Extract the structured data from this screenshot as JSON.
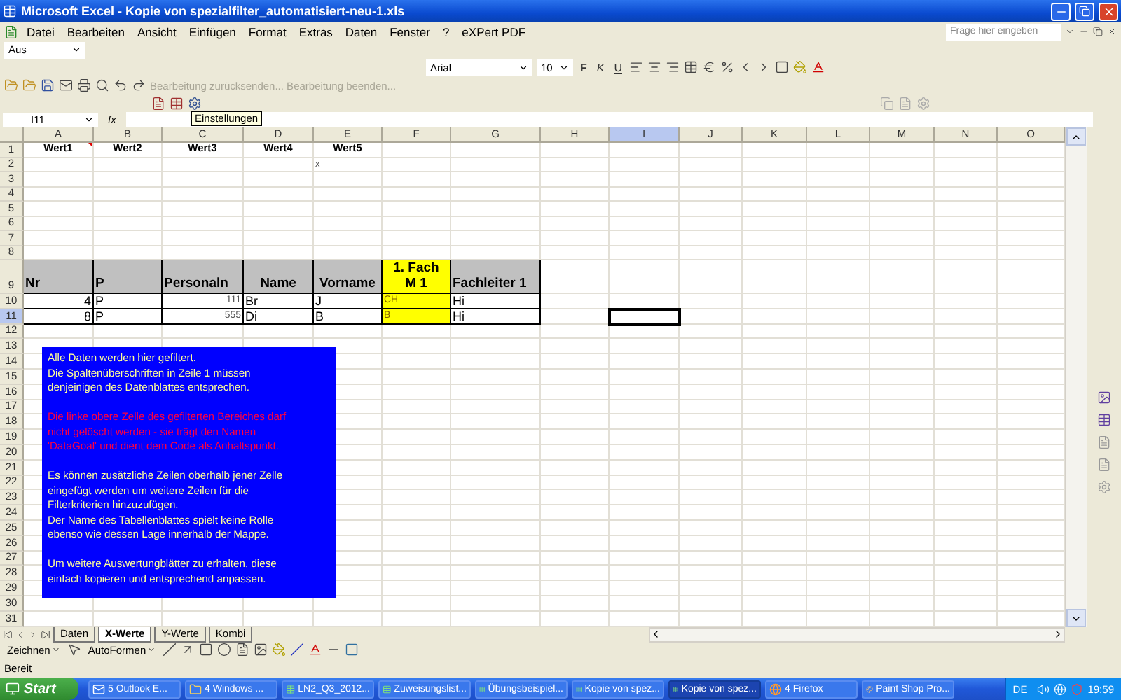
{
  "window": {
    "title": "Microsoft Excel - Kopie von spezialfilter_automatisiert-neu-1.xls"
  },
  "menu": [
    "Datei",
    "Bearbeiten",
    "Ansicht",
    "Einfügen",
    "Format",
    "Extras",
    "Daten",
    "Fenster",
    "?",
    "eXPert PDF"
  ],
  "help_search": {
    "placeholder": "Frage hier eingeben"
  },
  "style_box": {
    "value": "Aus"
  },
  "format_toolbar": {
    "font": "Arial",
    "size": "10",
    "buttons": [
      "F",
      "K",
      "U"
    ]
  },
  "review_toolbar": {
    "text": "Bearbeitung zurücksenden... Bearbeitung beenden...",
    "disabled": true
  },
  "tooltip": "Einstellungen",
  "formula_bar": {
    "name_box": "I11",
    "function_button": "fx"
  },
  "sheet": {
    "columns": [
      {
        "label": "A",
        "selected": false
      },
      {
        "label": "B",
        "selected": false
      },
      {
        "label": "C",
        "selected": false
      },
      {
        "label": "D",
        "selected": false
      },
      {
        "label": "E",
        "selected": false
      },
      {
        "label": "F",
        "selected": false
      },
      {
        "label": "G",
        "selected": false
      },
      {
        "label": "H",
        "selected": false
      },
      {
        "label": "I",
        "selected": true
      },
      {
        "label": "J",
        "selected": false
      },
      {
        "label": "K",
        "selected": false
      },
      {
        "label": "L",
        "selected": false
      },
      {
        "label": "M",
        "selected": false
      },
      {
        "label": "N",
        "selected": false
      },
      {
        "label": "O",
        "selected": false
      }
    ],
    "rows": [
      {
        "label": "1",
        "selected": false,
        "cells": [
          {
            "text": "Wert1",
            "kind": "label",
            "comment": true
          },
          {
            "text": "Wert2",
            "kind": "label"
          },
          {
            "text": "Wert3",
            "kind": "label"
          },
          {
            "text": "Wert4",
            "kind": "label"
          },
          {
            "text": "Wert5",
            "kind": "label"
          }
        ]
      },
      {
        "label": "2",
        "selected": false,
        "cells": [
          null,
          null,
          null,
          null,
          {
            "text": "x",
            "kind": "note"
          }
        ]
      },
      {
        "label": "3",
        "selected": false
      },
      {
        "label": "4",
        "selected": false
      },
      {
        "label": "5",
        "selected": false
      },
      {
        "label": "6",
        "selected": false
      },
      {
        "label": "7",
        "selected": false
      },
      {
        "label": "8",
        "selected": false
      },
      {
        "label": "9",
        "selected": false,
        "cells": [
          {
            "text": "Nr",
            "kind": "header"
          },
          {
            "text": "P",
            "kind": "header"
          },
          {
            "text": "Personaln",
            "kind": "header"
          },
          {
            "text": "Name",
            "kind": "centered_header"
          },
          {
            "text": "Vorname",
            "kind": "centered_header"
          },
          {
            "text": "1. Fach M 1",
            "kind": "highlight_header"
          },
          {
            "text": "Fachleiter 1",
            "kind": "header"
          }
        ]
      },
      {
        "label": "10",
        "selected": false,
        "cells": [
          {
            "text": "4",
            "kind": "number"
          },
          {
            "text": "P",
            "kind": "value"
          },
          {
            "text": "111",
            "kind": "small_value"
          },
          {
            "text": "Br",
            "kind": "value"
          },
          {
            "text": "J",
            "kind": "value"
          },
          {
            "text": "CH",
            "kind": "highlight_value"
          },
          {
            "text": "Hi",
            "kind": "value"
          }
        ]
      },
      {
        "label": "11",
        "selected": true,
        "cells": [
          {
            "text": "8",
            "kind": "number"
          },
          {
            "text": "P",
            "kind": "value"
          },
          {
            "text": "555",
            "kind": "small_value"
          },
          {
            "text": "Di",
            "kind": "value"
          },
          {
            "text": "B",
            "kind": "value"
          },
          {
            "text": "B",
            "kind": "highlight_value"
          },
          {
            "text": "Hi",
            "kind": "value"
          }
        ]
      },
      {
        "label": "12",
        "selected": false
      },
      {
        "label": "13",
        "selected": false
      },
      {
        "label": "14",
        "selected": false
      },
      {
        "label": "15",
        "selected": false
      },
      {
        "label": "16",
        "selected": false
      },
      {
        "label": "17",
        "selected": false
      },
      {
        "label": "18",
        "selected": false
      },
      {
        "label": "19",
        "selected": false
      },
      {
        "label": "20",
        "selected": false
      },
      {
        "label": "21",
        "selected": false
      },
      {
        "label": "22",
        "selected": false
      },
      {
        "label": "23",
        "selected": false
      },
      {
        "label": "24",
        "selected": false
      },
      {
        "label": "25",
        "selected": false
      },
      {
        "label": "26",
        "selected": false
      },
      {
        "label": "27",
        "selected": false
      },
      {
        "label": "28",
        "selected": false
      },
      {
        "label": "29",
        "selected": false
      },
      {
        "label": "30",
        "selected": false
      },
      {
        "label": "31",
        "selected": false
      }
    ]
  },
  "text_box": {
    "paragraphs": [
      {
        "text": "Alle Daten werden hier gefiltert.\nDie Spaltenüberschriften in Zeile 1 müssen\ndenjeinigen des Datenblattes entsprechen.",
        "color": "#ffff99"
      },
      {
        "text": "Die linke obere Zelle des gefilterten Bereiches darf\nnicht gelöscht werden - sie trägt den Namen\n'DataGoal' und dient dem Code als Anhaltspunkt.",
        "color": "#ff0040"
      },
      {
        "text": "Es können zusätzliche Zeilen oberhalb jener Zelle\neingefügt werden um weitere Zeilen für die\nFilterkriterien hinzuzufügen.\nDer Name des Tabellenblattes spielt keine Rolle\nebenso wie dessen Lage innerhalb der Mappe.",
        "color": "#ffff99"
      },
      {
        "text": "Um weitere Auswertungblätter zu erhalten, diese\neinfach kopieren und entsprechend anpassen.",
        "color": "#ffff99"
      }
    ]
  },
  "sheet_tabs": [
    {
      "label": "Daten",
      "selected": false
    },
    {
      "label": "X-Werte",
      "selected": true
    },
    {
      "label": "Y-Werte",
      "selected": false
    },
    {
      "label": "Kombi",
      "selected": false
    }
  ],
  "drawing_toolbar": {
    "draw_menu": "Zeichnen",
    "shapes_menu": "AutoFormen"
  },
  "status_bar": "Bereit",
  "taskbar": {
    "start": "Start",
    "items": [
      {
        "label": "5 Outlook E...",
        "kind": "mail",
        "selected": false
      },
      {
        "label": "4 Windows ...",
        "kind": "folder",
        "selected": false
      },
      {
        "label": "LN2_Q3_2012...",
        "kind": "sheet",
        "selected": false
      },
      {
        "label": "Zuweisungslist...",
        "kind": "sheet",
        "selected": false
      },
      {
        "label": "Übungsbeispiel...",
        "kind": "sheet",
        "selected": false
      },
      {
        "label": "Kopie von spez...",
        "kind": "sheet",
        "selected": false
      },
      {
        "label": "Kopie von spez...",
        "kind": "sheet",
        "selected": true
      },
      {
        "label": "4 Firefox",
        "kind": "browser",
        "selected": false
      },
      {
        "label": "Paint Shop Pro...",
        "kind": "paint",
        "selected": false
      }
    ],
    "language": "DE",
    "clock": "19:59"
  }
}
